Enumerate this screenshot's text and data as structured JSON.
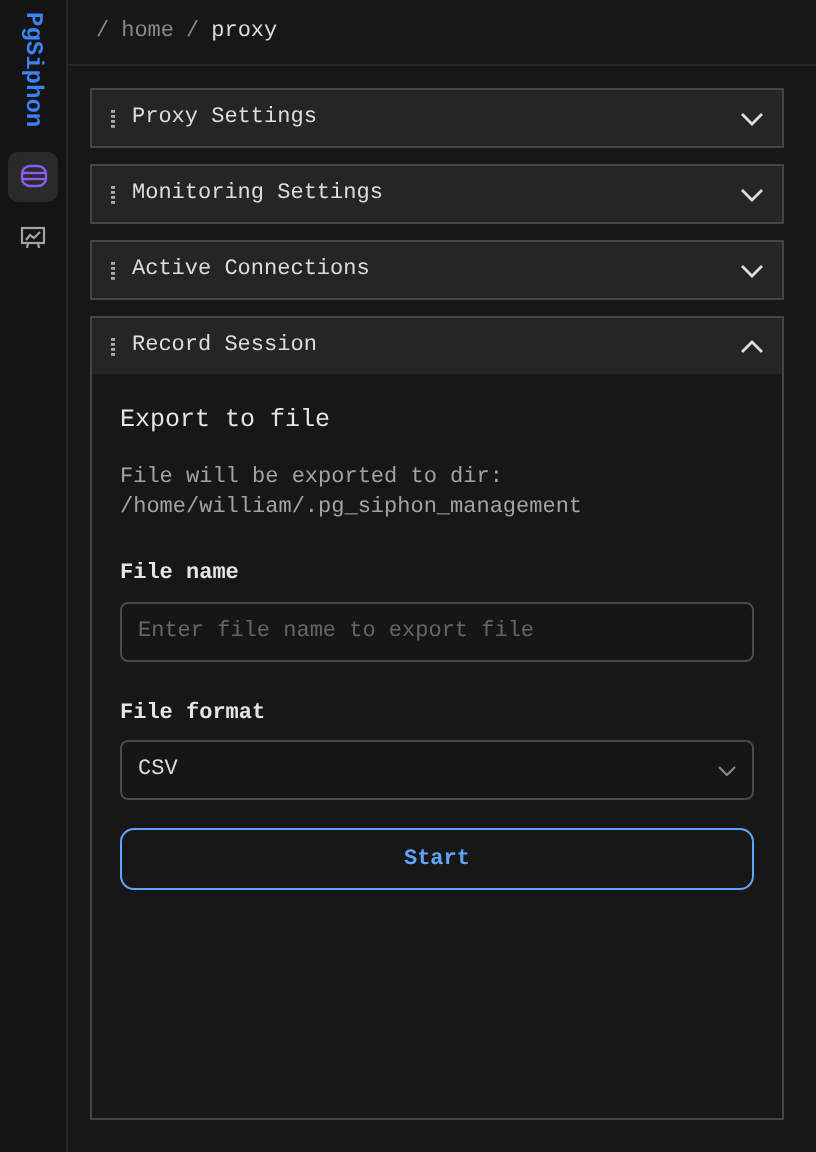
{
  "sidebar": {
    "logo": "PgSiphon",
    "items": [
      {
        "kind": "database",
        "selected": true
      },
      {
        "kind": "chart",
        "selected": false
      }
    ]
  },
  "breadcrumb": {
    "separator": "/",
    "items": [
      {
        "label": "home",
        "current": false
      },
      {
        "label": "proxy",
        "current": true
      }
    ]
  },
  "sections": [
    {
      "title": "Proxy Settings",
      "expanded": false
    },
    {
      "title": "Monitoring Settings",
      "expanded": false
    },
    {
      "title": "Active Connections",
      "expanded": false
    },
    {
      "title": "Record Session",
      "expanded": true,
      "body": {
        "heading": "Export to file",
        "note": "File will be exported to dir:",
        "path": "/home/william/.pg_siphon_management",
        "file_name": {
          "label": "File name",
          "placeholder": "Enter file name to export file"
        },
        "file_format": {
          "label": "File format",
          "value": "CSV"
        },
        "button": "Start"
      }
    }
  ]
}
